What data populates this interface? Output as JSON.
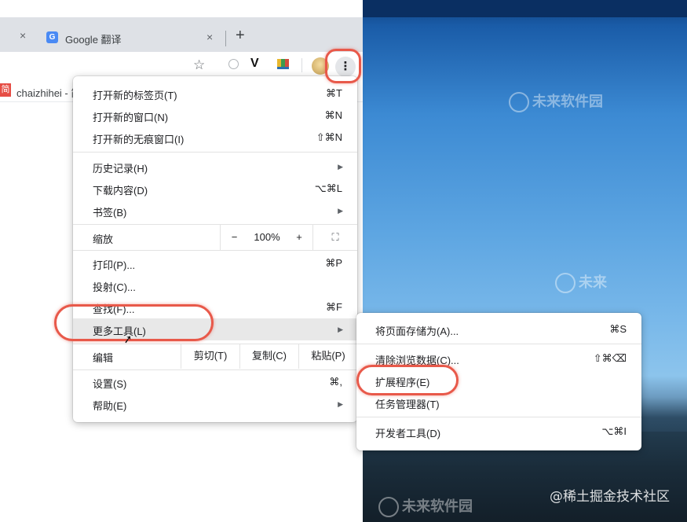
{
  "desktop": {
    "watermark_1": "未来软件园",
    "watermark_2": "未来",
    "watermark_3": "未来软件园",
    "credit": "@稀土掘金技术社区"
  },
  "browser": {
    "tab": {
      "favicon_text": "G",
      "title": "Google 翻译",
      "close": "×"
    },
    "prev_tab_close": "×",
    "new_tab": "+",
    "toolbar": {
      "star": "☆",
      "ext_v": "V",
      "menu_button": "⋮"
    },
    "bookmark": {
      "icon_text": "简",
      "label": "chaizhihei - 简"
    }
  },
  "menu": {
    "new_tab": {
      "label": "打开新的标签页(T)",
      "shortcut": "⌘T"
    },
    "new_window": {
      "label": "打开新的窗口(N)",
      "shortcut": "⌘N"
    },
    "incognito": {
      "label": "打开新的无痕窗口(I)",
      "shortcut": "⇧⌘N"
    },
    "history": {
      "label": "历史记录(H)",
      "arrow": "▶"
    },
    "downloads": {
      "label": "下载内容(D)",
      "shortcut": "⌥⌘L"
    },
    "bookmarks": {
      "label": "书签(B)",
      "arrow": "▶"
    },
    "zoom": {
      "label": "缩放",
      "minus": "−",
      "value": "100%",
      "plus": "+",
      "fullscreen": "⛶"
    },
    "print": {
      "label": "打印(P)...",
      "shortcut": "⌘P"
    },
    "cast": {
      "label": "投射(C)..."
    },
    "find": {
      "label": "查找(F)...",
      "shortcut": "⌘F"
    },
    "more_tools": {
      "label": "更多工具(L)",
      "arrow": "▶"
    },
    "edit": {
      "label": "编辑",
      "cut": "剪切(T)",
      "copy": "复制(C)",
      "paste": "粘贴(P)"
    },
    "settings": {
      "label": "设置(S)",
      "shortcut": "⌘,"
    },
    "help": {
      "label": "帮助(E)",
      "arrow": "▶"
    }
  },
  "submenu": {
    "save_page": {
      "label": "将页面存储为(A)...",
      "shortcut": "⌘S"
    },
    "clear_data": {
      "label": "清除浏览数据(C)...",
      "shortcut": "⇧⌘⌫"
    },
    "extensions": {
      "label": "扩展程序(E)"
    },
    "task_manager": {
      "label": "任务管理器(T)"
    },
    "dev_tools": {
      "label": "开发者工具(D)",
      "shortcut": "⌥⌘I"
    }
  },
  "colors": {
    "highlight_ring": "#e8594a",
    "menu_hover": "#e8e8e8",
    "tab_strip": "#dee1e6"
  }
}
